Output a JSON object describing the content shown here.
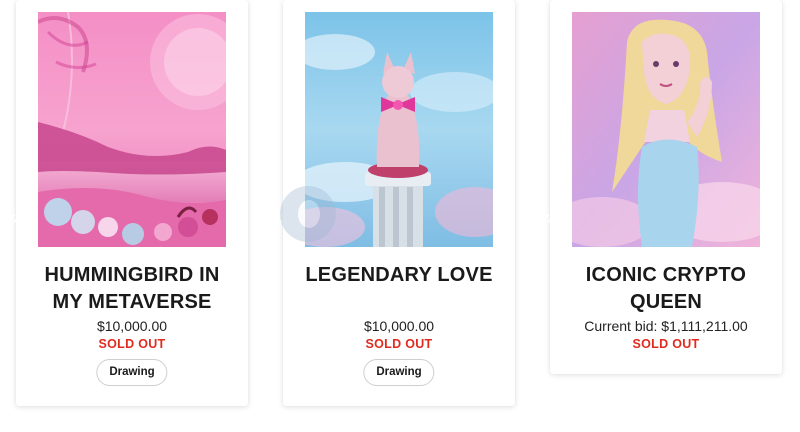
{
  "cards": [
    {
      "title_line1": "HUMMINGBIRD IN",
      "title_line2": "MY METAVERSE",
      "price": "$10,000.00",
      "status": "SOLD OUT",
      "tag": "Drawing"
    },
    {
      "title_line1": "LEGENDARY LOVE",
      "title_line2": "",
      "price": "$10,000.00",
      "status": "SOLD OUT",
      "tag": "Drawing"
    },
    {
      "title_line1": "ICONIC CRYPTO",
      "title_line2": "QUEEN",
      "price": "Current bid: $1,111,211.00",
      "status": "SOLD OUT"
    }
  ],
  "icons": {
    "video": "video-camera-icon",
    "spin": "rotate-3d-icon"
  },
  "colors": {
    "status": "#e02b20",
    "title": "#1a1a1a",
    "tag_border": "#cfcfcf"
  }
}
